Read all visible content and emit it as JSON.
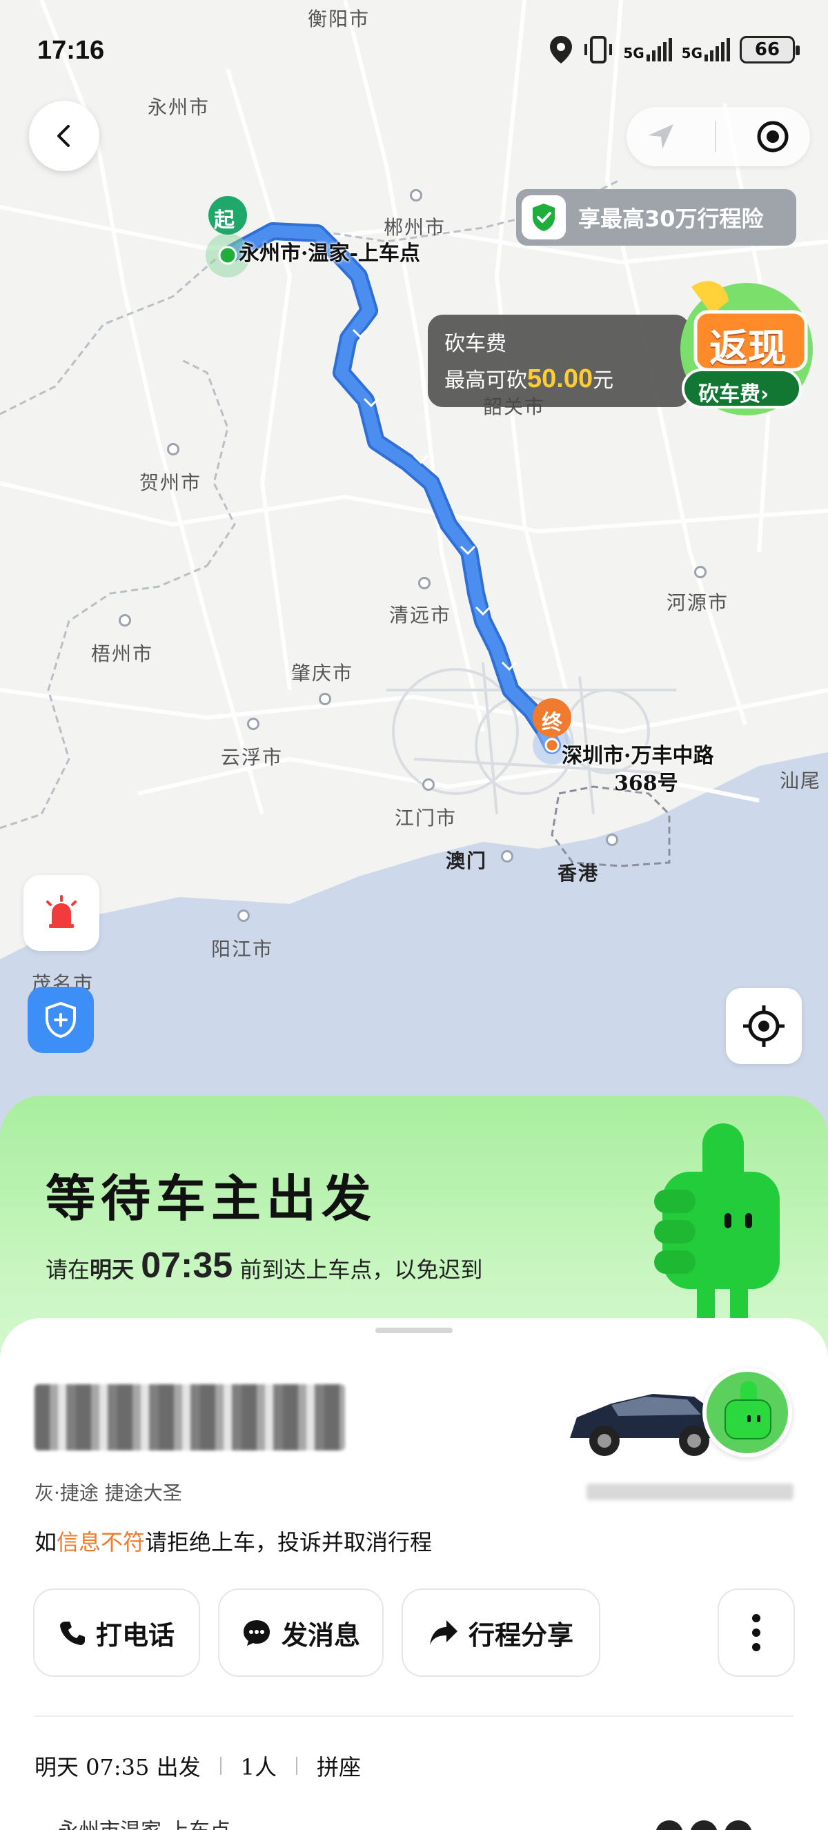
{
  "status_bar": {
    "time": "17:16",
    "battery": "66",
    "net1": "5G",
    "net2": "5G"
  },
  "map": {
    "cities": [
      {
        "name": "衡阳市"
      },
      {
        "name": "永州市"
      },
      {
        "name": "郴州市"
      },
      {
        "name": "韶关市"
      },
      {
        "name": "贺州市"
      },
      {
        "name": "河源市"
      },
      {
        "name": "清远市"
      },
      {
        "name": "梧州市"
      },
      {
        "name": "肇庆市"
      },
      {
        "name": "云浮市"
      },
      {
        "name": "江门市"
      },
      {
        "name": "澳门"
      },
      {
        "name": "香港"
      },
      {
        "name": "汕尾"
      },
      {
        "name": "阳江市"
      },
      {
        "name": "茂名市"
      }
    ],
    "start_marker": "起",
    "end_marker": "终",
    "start_label": "永州市·温家-上车点",
    "end_label_1": "深圳市·万丰中路",
    "end_label_2": "368号",
    "insurance_text": "享最高30万行程险",
    "promo_line1": "砍车费",
    "promo_line2_prefix": "最高可砍",
    "promo_amount": "50.00",
    "promo_unit": "元",
    "badge_title": "返现",
    "badge_button": "砍车费›"
  },
  "status_card": {
    "title": "等待车主出发",
    "sub_prefix": "请在",
    "sub_day": "明天",
    "sub_time": "07:35",
    "sub_suffix": "前到达上车点，以免迟到"
  },
  "driver": {
    "car_desc": "灰·捷途 捷途大圣",
    "warning_prefix": "如",
    "warning_highlight": "信息不符",
    "warning_suffix": "请拒绝上车，投诉并取消行程"
  },
  "actions": {
    "call": "打电话",
    "message": "发消息",
    "share": "行程分享"
  },
  "trip": {
    "depart": "明天 07:35 出发",
    "people": "1人",
    "mode": "拼座",
    "pickup": "永州市温家-上车点"
  },
  "colors": {
    "route": "#3d7fe0",
    "accent": "#f07a2e",
    "green": "#5cd05c"
  }
}
